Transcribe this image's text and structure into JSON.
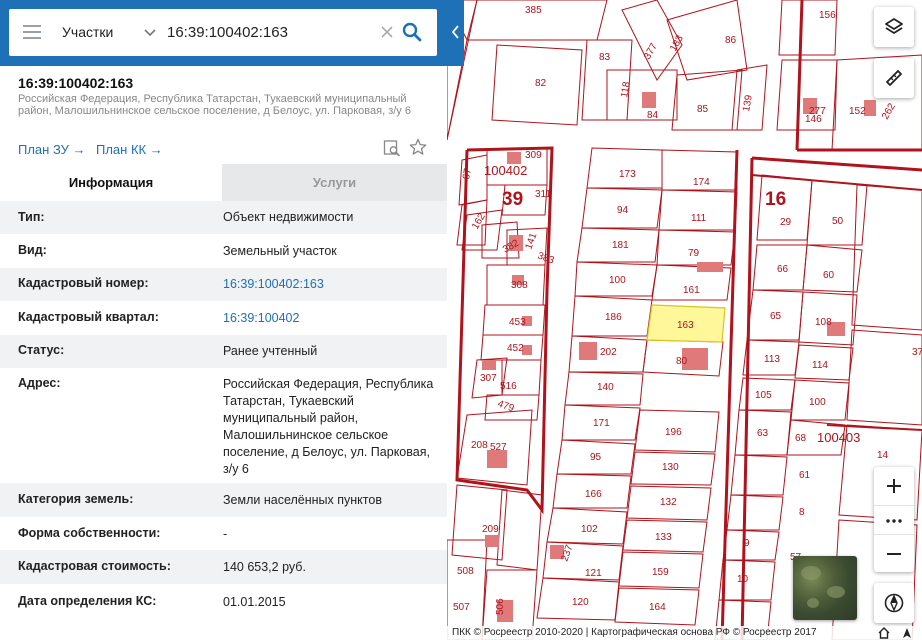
{
  "search": {
    "type_label": "Участки",
    "query": "16:39:100402:163"
  },
  "object": {
    "title": "16:39:100402:163",
    "address": "Российская Федерация, Республика Татарстан, Тукаевский муниципальный район, Малошильнинское сельское поселение, д Белоус, ул. Парковая, з/у 6",
    "plan_zu": "План ЗУ",
    "plan_kk": "План КК",
    "arrow": "→"
  },
  "tabs": {
    "info": "Информация",
    "services": "Услуги"
  },
  "info_rows": [
    {
      "label": "Тип:",
      "value": "Объект недвижимости"
    },
    {
      "label": "Вид:",
      "value": "Земельный участок"
    },
    {
      "label": "Кадастровый номер:",
      "value": "16:39:100402:163"
    },
    {
      "label": "Кадастровый квартал:",
      "value": "16:39:100402"
    },
    {
      "label": "Статус:",
      "value": "Ранее учтенный"
    },
    {
      "label": "Адрес:",
      "value": "Российская Федерация, Республика Татарстан, Тукаевский муниципальный район, Малошильнинское сельское поселение, д Белоус, ул. Парковая, з/у 6"
    },
    {
      "label": "Категория земель:",
      "value": "Земли населённых пунктов"
    },
    {
      "label": "Форма собственности:",
      "value": "-"
    },
    {
      "label": "Кадастровая стоимость:",
      "value": "140 653,2 руб."
    },
    {
      "label": "Дата определения КС:",
      "value": "01.01.2015"
    }
  ],
  "map": {
    "copyright": "ПКК © Росреестр 2010-2020 | Картографическая основа РФ © Росреестр 2017",
    "quarter_labels": [
      "100402",
      "100403"
    ],
    "district_labels": [
      "39",
      "16"
    ],
    "parcel_labels": [
      "385",
      "156",
      "83",
      "377",
      "183",
      "86",
      "82",
      "118",
      "84",
      "85",
      "139",
      "277",
      "146",
      "152",
      "262",
      "309",
      "311",
      "67",
      "173",
      "174",
      "94",
      "111",
      "29",
      "50",
      "162",
      "141",
      "181",
      "79",
      "382",
      "383",
      "66",
      "60",
      "308",
      "100",
      "161",
      "186",
      "163",
      "65",
      "108",
      "453",
      "452",
      "202",
      "80",
      "113",
      "114",
      "37",
      "307",
      "516",
      "140",
      "105",
      "100",
      "479",
      "171",
      "196",
      "63",
      "68",
      "208",
      "527",
      "95",
      "130",
      "14",
      "166",
      "132",
      "61",
      "209",
      "102",
      "133",
      "8",
      "237",
      "508",
      "121",
      "159",
      "9",
      "57",
      "506",
      "10",
      "507",
      "120",
      "164"
    ],
    "selected_parcel": "163",
    "colors": {
      "boundary": "#b0131b",
      "selected_fill": "#fff79a",
      "building": "#e07a7a"
    }
  },
  "icons": {
    "menu": "menu-icon",
    "chevron": "chevron-down-icon",
    "clear": "close-icon",
    "search": "search-icon",
    "layers": "layers-icon",
    "ruler": "ruler-icon",
    "zoom_in": "plus-icon",
    "zoom_more": "more-icon",
    "zoom_out": "minus-icon",
    "compass": "compass-icon",
    "star": "star-icon",
    "map_search": "map-search-icon"
  }
}
